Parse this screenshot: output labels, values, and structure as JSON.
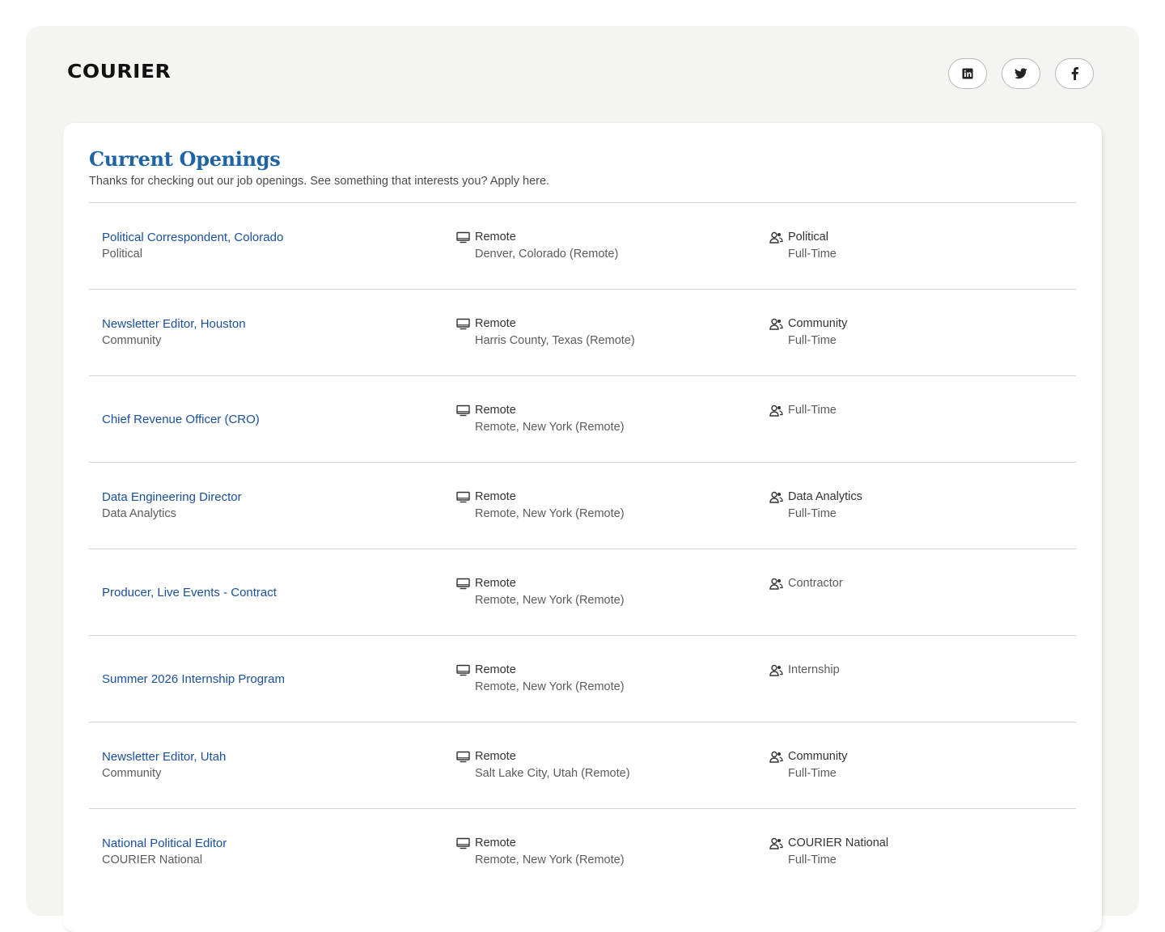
{
  "brand": {
    "logo": "COURIER"
  },
  "social": [
    {
      "name": "linkedin-icon",
      "label": "LinkedIn"
    },
    {
      "name": "twitter-icon",
      "label": "Twitter"
    },
    {
      "name": "facebook-icon",
      "label": "Facebook"
    }
  ],
  "openings": {
    "title": "Current Openings",
    "subtitle": "Thanks for checking out our job openings. See something that interests you? Apply here.",
    "jobs": [
      {
        "title": "Political Correspondent, Colorado",
        "team": "Political",
        "workplace": "Remote",
        "location": "Denver, Colorado (Remote)",
        "department": "Political",
        "employment": "Full-Time"
      },
      {
        "title": "Newsletter Editor, Houston",
        "team": "Community",
        "workplace": "Remote",
        "location": "Harris County, Texas (Remote)",
        "department": "Community",
        "employment": "Full-Time"
      },
      {
        "title": "Chief Revenue Officer (CRO)",
        "team": "",
        "workplace": "Remote",
        "location": "Remote, New York (Remote)",
        "department": "",
        "employment": "Full-Time"
      },
      {
        "title": "Data Engineering Director",
        "team": "Data Analytics",
        "workplace": "Remote",
        "location": "Remote, New York (Remote)",
        "department": "Data Analytics",
        "employment": "Full-Time"
      },
      {
        "title": "Producer, Live Events - Contract",
        "team": "",
        "workplace": "Remote",
        "location": "Remote, New York (Remote)",
        "department": "",
        "employment": "Contractor"
      },
      {
        "title": "Summer 2026 Internship Program",
        "team": "",
        "workplace": "Remote",
        "location": "Remote, New York (Remote)",
        "department": "",
        "employment": "Internship"
      },
      {
        "title": "Newsletter Editor, Utah",
        "team": "Community",
        "workplace": "Remote",
        "location": "Salt Lake City, Utah (Remote)",
        "department": "Community",
        "employment": "Full-Time"
      },
      {
        "title": "National Political Editor",
        "team": "COURIER National",
        "workplace": "Remote",
        "location": "Remote, New York (Remote)",
        "department": "COURIER National",
        "employment": "Full-Time"
      }
    ]
  },
  "icons": {
    "workplace": "monitor-icon",
    "department": "people-icon"
  },
  "colors": {
    "link": "#1a4f9c",
    "title": "#1e63a6",
    "page_bg": "#f4f4f0"
  }
}
